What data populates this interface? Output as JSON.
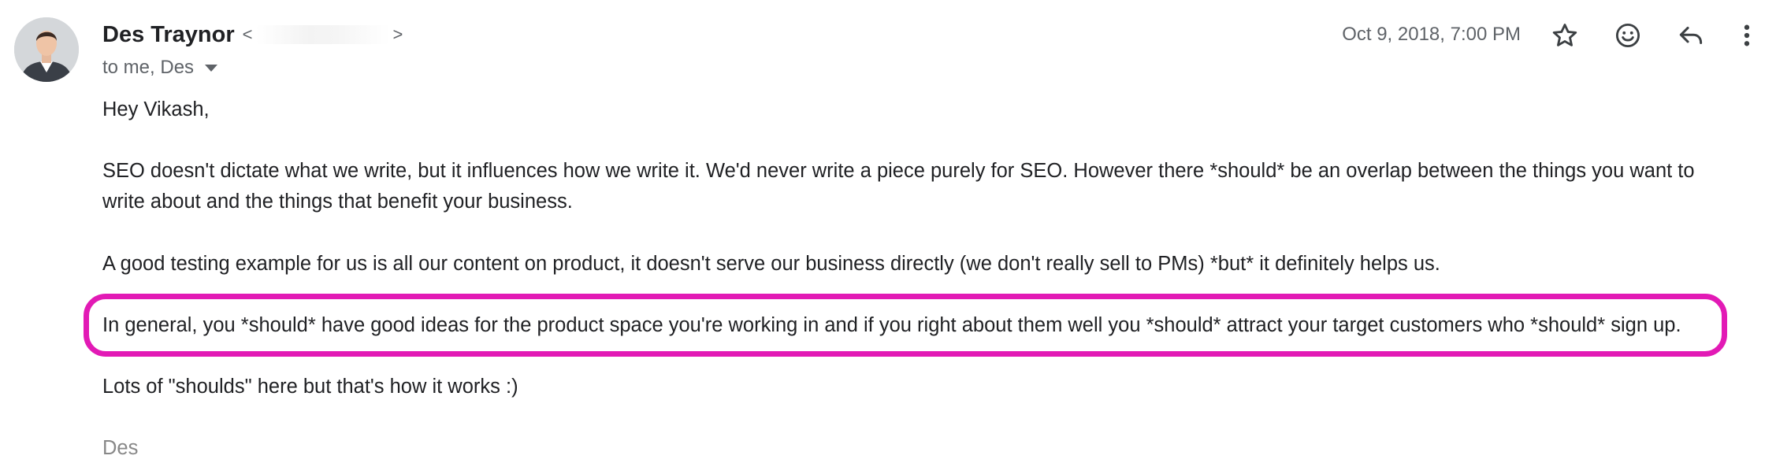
{
  "sender": {
    "name": "Des Traynor",
    "email_prefix": "<",
    "email_suffix": ">"
  },
  "recipients": {
    "label": "to me, Des"
  },
  "header": {
    "date": "Oct 9, 2018, 7:00 PM"
  },
  "actions": {
    "star_icon": "star-icon",
    "emoji_icon": "emoji-reaction-icon",
    "reply_icon": "reply-icon",
    "more_icon": "more-vertical-icon"
  },
  "message": {
    "greeting": "Hey Vikash,",
    "paragraph1": "SEO doesn't dictate what we write, but it influences how we write it. We'd never write a piece purely for SEO. However there *should* be an overlap between the things you want to write about and the things that benefit your business.",
    "paragraph2": "A good testing example for us is all our content on product, it doesn't serve our business directly (we don't really sell to PMs) *but* it definitely helps us.",
    "paragraph3": "In general, you *should* have good ideas for the product space you're working in and if you right about them well you *should* attract your target customers who *should* sign up.",
    "paragraph4": "Lots of  \"shoulds\" here but that's how it works :)",
    "signature": "Des"
  },
  "colors": {
    "highlight": "#e21ab5",
    "muted_text": "#5f6368"
  }
}
